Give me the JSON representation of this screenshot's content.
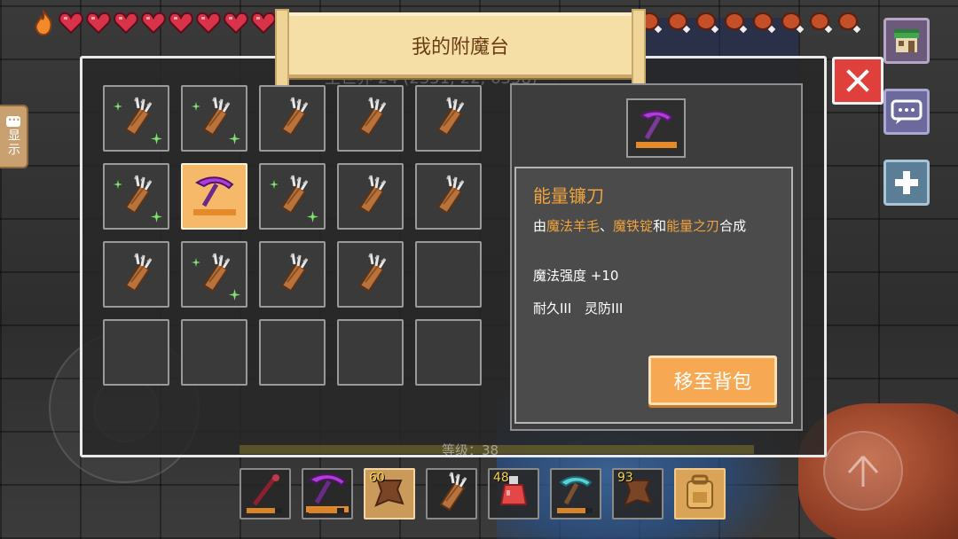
{
  "title": "我的附魔台",
  "coord_text": "主世界 24 (2351, 22, 6358)",
  "side_tab_label": "显示",
  "grid": {
    "slots": [
      {
        "item": "quiver",
        "enchanted": true
      },
      {
        "item": "quiver",
        "enchanted": true
      },
      {
        "item": "quiver",
        "enchanted": false
      },
      {
        "item": "quiver",
        "enchanted": false
      },
      {
        "item": "quiver",
        "enchanted": false
      },
      {
        "item": "quiver",
        "enchanted": true
      },
      {
        "item": "pickaxe",
        "enchanted": false,
        "selected": true
      },
      {
        "item": "quiver",
        "enchanted": true
      },
      {
        "item": "quiver",
        "enchanted": false
      },
      {
        "item": "quiver",
        "enchanted": false
      },
      {
        "item": "quiver",
        "enchanted": false
      },
      {
        "item": "quiver",
        "enchanted": true
      },
      {
        "item": "quiver",
        "enchanted": false
      },
      {
        "item": "quiver",
        "enchanted": false
      },
      {
        "item": "empty"
      },
      {
        "item": "empty"
      },
      {
        "item": "empty"
      },
      {
        "item": "empty"
      },
      {
        "item": "empty"
      },
      {
        "item": "empty"
      }
    ]
  },
  "detail": {
    "item_name": "能量镰刀",
    "recipe": {
      "prefix": "由",
      "ing1": "魔法羊毛",
      "sep1": "、",
      "ing2": "魔铁锭",
      "sep2": "和",
      "ing3": "能量之刃",
      "suffix": "合成"
    },
    "stat1": "魔法强度 +10",
    "stat2": "耐久III 灵防III",
    "move_button": "移至背包"
  },
  "level_label": "等级：38",
  "hotbar": [
    {
      "item": "staff",
      "count": ""
    },
    {
      "item": "pickaxe",
      "count": ""
    },
    {
      "item": "leather",
      "count": "60",
      "active": true
    },
    {
      "item": "quiver",
      "count": ""
    },
    {
      "item": "potion",
      "count": "48"
    },
    {
      "item": "diamond-pickaxe",
      "count": ""
    },
    {
      "item": "leather",
      "count": "93"
    },
    {
      "item": "backpack",
      "count": ""
    }
  ],
  "colors": {
    "accent_orange": "#f0a33c",
    "button_orange": "#f6a952",
    "close_red": "#e0403c",
    "heart_red": "#d9334a",
    "pickaxe_purple": "#b23cd8"
  },
  "hud": {
    "hearts": 10,
    "hunger": 10
  }
}
